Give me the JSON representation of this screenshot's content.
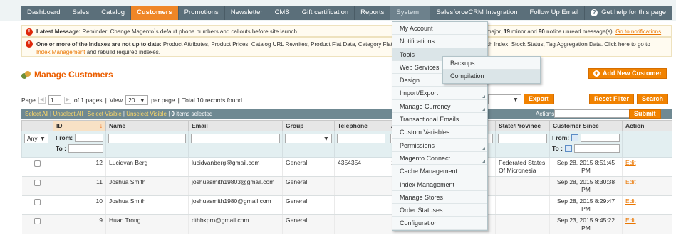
{
  "nav": {
    "items": [
      "Dashboard",
      "Sales",
      "Catalog",
      "Customers",
      "Promotions",
      "Newsletter",
      "CMS",
      "Gift certification",
      "Reports",
      "System",
      "SalesforceCRM Integration",
      "Follow Up Email"
    ],
    "help": "Get help for this page"
  },
  "messages": {
    "latest_label": "Latest Message:",
    "latest_text": "Reminder: Change Magento`s default phone numbers and callouts before site launch",
    "latest_right_pre": "major,",
    "minor_count": "19",
    "minor_word": "minor and",
    "notice_count": "90",
    "notice_word": "notice unread message(s).",
    "latest_link": "Go to notifications",
    "index_bold": "One or more of the Indexes are not up to date:",
    "index_text": "Product Attributes, Product Prices, Catalog URL Rewrites, Product Flat Data, Category Flat D",
    "index_text_right": "ch Index, Stock Status, Tag Aggregation Data. Click here to go to",
    "index_link": "Index Management",
    "index_tail": "and rebuild required indexes."
  },
  "page": {
    "title": "Manage Customers",
    "add_button": "Add New Customer"
  },
  "pager": {
    "page_label": "Page",
    "page_value": "1",
    "of_pages": "of 1 pages",
    "view_label": "View",
    "per_page": "20",
    "per_page_label": "per page",
    "total": "Total 10 records found"
  },
  "toolbar": {
    "export": "Export",
    "reset": "Reset Filter",
    "search": "Search"
  },
  "massaction": {
    "select_all": "Select All",
    "unselect_all": "Unselect All",
    "select_visible": "Select Visible",
    "unselect_visible": "Unselect Visible",
    "selected_count": "0",
    "selected_label": "items selected",
    "actions_label": "Actions",
    "submit": "Submit"
  },
  "grid": {
    "columns": [
      "",
      "ID",
      "Name",
      "Email",
      "Group",
      "Telephone",
      "Z",
      "",
      "State/Province",
      "Customer Since",
      "Action"
    ],
    "filter": {
      "any": "Any",
      "from": "From:",
      "to": "To :"
    },
    "rows": [
      {
        "id": "12",
        "name": "Lucidvan Berg",
        "email": "lucidvanberg@gmail.com",
        "group": "General",
        "telephone": "4354354",
        "zip": "1",
        "state_1": "Federated States",
        "state_2": "Of Micronesia",
        "since_1": "Sep 28, 2015 8:51:45",
        "since_2": "PM",
        "action": "Edit"
      },
      {
        "id": "11",
        "name": "Joshua Smith",
        "email": "joshuasmith19803@gmail.com",
        "group": "General",
        "telephone": "",
        "zip": "",
        "state_1": "",
        "state_2": "",
        "since_1": "Sep 28, 2015 8:30:38",
        "since_2": "PM",
        "action": "Edit"
      },
      {
        "id": "10",
        "name": "Joshua Smith",
        "email": "joshuasmith1980@gmail.com",
        "group": "General",
        "telephone": "",
        "zip": "",
        "state_1": "",
        "state_2": "",
        "since_1": "Sep 28, 2015 8:29:47",
        "since_2": "PM",
        "action": "Edit"
      },
      {
        "id": "9",
        "name": "Huan Trong",
        "email": "dthbkpro@gmail.com",
        "group": "General",
        "telephone": "",
        "zip": "",
        "state_1": "",
        "state_2": "",
        "since_1": "Sep 23, 2015 9:45:22",
        "since_2": "PM",
        "action": "Edit"
      }
    ]
  },
  "system_menu": {
    "items": [
      "My Account",
      "Notifications",
      "Tools",
      "Web Services",
      "Design",
      "Import/Export",
      "Manage Currency",
      "Transactional Emails",
      "Custom Variables",
      "Permissions",
      "Magento Connect",
      "Cache Management",
      "Index Management",
      "Manage Stores",
      "Order Statuses",
      "Configuration"
    ],
    "tools_submenu": [
      "Backups",
      "Compilation"
    ]
  },
  "colors": {
    "accent": "#f18200",
    "nav": "#5b6f7a",
    "title": "#eb5e00"
  }
}
